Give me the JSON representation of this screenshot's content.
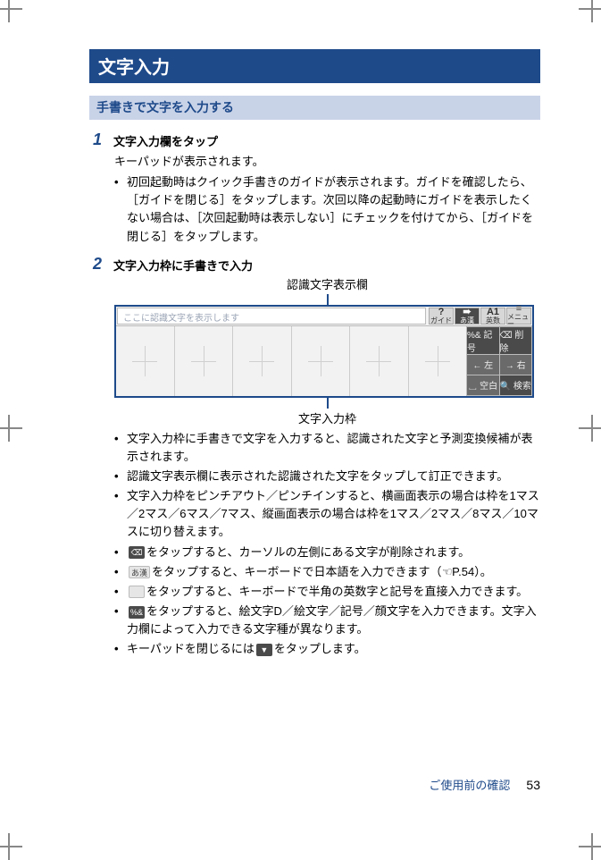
{
  "section_title": "文字入力",
  "subsection_title": "手書きで文字を入力する",
  "steps": [
    {
      "num": "1",
      "title": "文字入力欄をタップ",
      "intro": "キーパッドが表示されます。",
      "bullets": [
        "初回起動時はクイック手書きのガイドが表示されます。ガイドを確認したら、［ガイドを閉じる］をタップします。次回以降の起動時にガイドを表示したくない場合は、［次回起動時は表示しない］にチェックを付けてから、［ガイドを閉じる］をタップします。"
      ]
    },
    {
      "num": "2",
      "title": "文字入力枠に手書きで入力",
      "fig": {
        "top_label": "認識文字表示欄",
        "bottom_label": "文字入力枠",
        "recog_placeholder": "ここに認識文字を表示します",
        "top_buttons": [
          {
            "big": "?",
            "small": "ガイド"
          },
          {
            "big": "➠",
            "small": "あ漢"
          },
          {
            "big": "A1",
            "small": "英数"
          },
          {
            "big": "≡",
            "small": "メニュー"
          }
        ],
        "side_keys": [
          "%&\n記号",
          "⌫\n削除",
          "←\n左",
          "→\n右",
          "␣\n空白",
          "🔍\n検索"
        ]
      },
      "bullets_after": [
        {
          "text": "文字入力枠に手書きで文字を入力すると、認識された文字と予測変換候補が表示されます。"
        },
        {
          "text": "認識文字表示欄に表示された認識された文字をタップして訂正できます。"
        },
        {
          "text": "文字入力枠をピンチアウト／ピンチインすると、横画面表示の場合は枠を1マス／2マス／6マス／7マス、縦画面表示の場合は枠を1マス／2マス／8マス／10マスに切り替えます。"
        },
        {
          "key": "del",
          "key_label": "⌫",
          "text_after": "をタップすると、カーソルの左側にある文字が削除されます。"
        },
        {
          "key": "kana",
          "key_label": "あ漢",
          "text_after_a": "をタップすると、キーボードで日本語を入力できます（",
          "ref": "P.54",
          "text_after_b": "）。"
        },
        {
          "key": "alnum",
          "key_label": "",
          "text_after": "をタップすると、キーボードで半角の英数字と記号を直接入力できます。"
        },
        {
          "key": "sym",
          "key_label": "%&",
          "text_after": "をタップすると、絵文字D／絵文字／記号／顔文字を入力できます。文字入力欄によって入力できる文字種が異なります。"
        },
        {
          "text_prefix": "キーパッドを閉じるには",
          "key": "close",
          "key_label": "▼",
          "text_after": "をタップします。"
        }
      ]
    }
  ],
  "footer": {
    "section": "ご使用前の確認",
    "page": "53"
  }
}
